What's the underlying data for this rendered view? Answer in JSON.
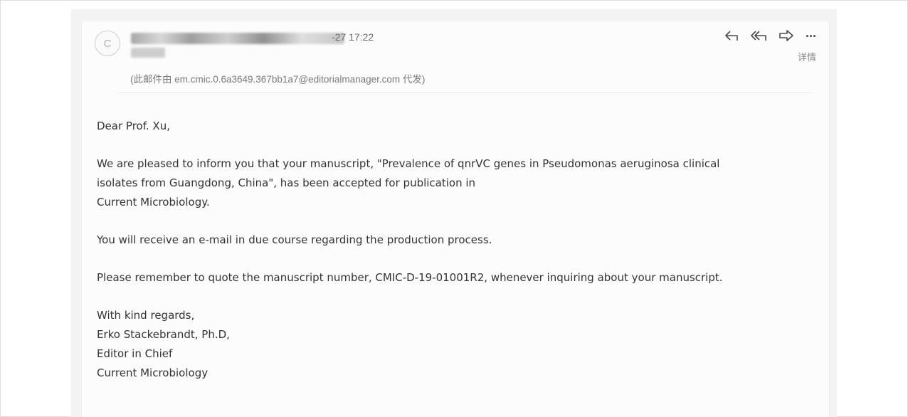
{
  "header": {
    "sender_visible_suffix": "(CMIC)",
    "datetime_visible": "-27 17:22",
    "avatar_letter": "C",
    "on_behalf_text": "(此邮件由 em.cmic.0.6a3649.367bb1a7@editorialmanager.com 代发)",
    "details_label": "详情",
    "actions": [
      "reply-icon",
      "reply-all-icon",
      "forward-icon",
      "more-icon"
    ],
    "more_glyph": "···"
  },
  "email": {
    "greeting": "Dear Prof. Xu,",
    "para1_lines": [
      "We are pleased to inform you that your manuscript, \"Prevalence of qnrVC genes in Pseudomonas aeruginosa clinical",
      "isolates from Guangdong, China\", has been accepted for publication in",
      "Current Microbiology."
    ],
    "para2": "You will receive an e-mail in due course regarding the production process.",
    "para3": "Please remember to quote the manuscript number, CMIC-D-19-01001R2, whenever inquiring about your manuscript.",
    "signature_lines": [
      "With kind regards,",
      "Erko Stackebrandt, Ph.D,",
      "Editor in Chief",
      "Current Microbiology"
    ]
  },
  "colors": {
    "text": "#333333",
    "muted": "#7a7a7a",
    "icon": "#4a4a4a"
  }
}
